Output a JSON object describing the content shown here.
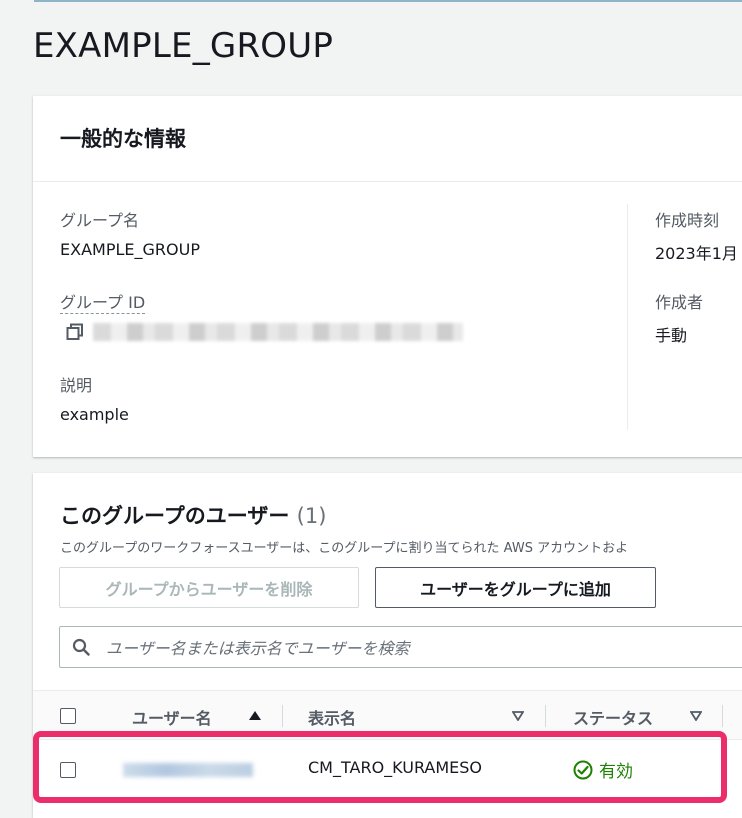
{
  "page": {
    "title": "EXAMPLE_GROUP"
  },
  "general_info": {
    "heading": "一般的な情報",
    "group_name_label": "グループ名",
    "group_name_value": "EXAMPLE_GROUP",
    "group_id_label": "グループ ID",
    "description_label": "説明",
    "description_value": "example",
    "created_time_label": "作成時刻",
    "created_time_value": "2023年1月",
    "created_by_label": "作成者",
    "created_by_value": "手動"
  },
  "users_panel": {
    "heading": "このグループのユーザー",
    "count": "(1)",
    "description": "このグループのワークフォースユーザーは、このグループに割り当てられた AWS アカウントおよ",
    "remove_button_label": "グループからユーザーを削除",
    "add_button_label": "ユーザーをグループに追加",
    "search_placeholder": "ユーザー名または表示名でユーザーを検索",
    "columns": [
      "ユーザー名",
      "表示名",
      "ステータス"
    ],
    "rows": [
      {
        "display_name": "CM_TARO_KURAMESO",
        "status": "有効"
      }
    ]
  },
  "colors": {
    "accent_highlight": "#ec2d6b",
    "status_active": "#1d8102"
  },
  "icons": [
    "copy-icon",
    "search-icon",
    "sort-ascending-icon",
    "sort-descending-icon",
    "check-circle-icon"
  ]
}
